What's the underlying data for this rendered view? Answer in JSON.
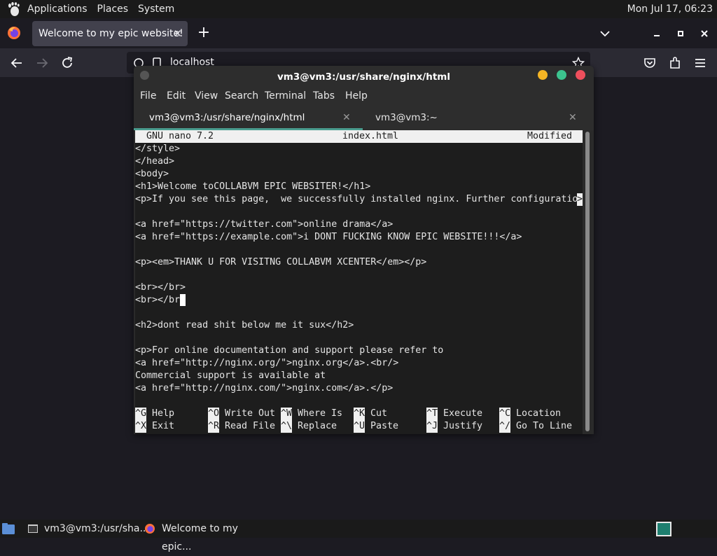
{
  "top_panel": {
    "menus": [
      "Applications",
      "Places",
      "System"
    ],
    "clock": "Mon Jul 17, 06:23"
  },
  "firefox": {
    "tab_title": "Welcome to my epic website!",
    "close_glyph": "✕",
    "newtab_glyph": "+",
    "url": "localhost",
    "icons": [
      "firefox-logo",
      "list-all-tabs",
      "minimize",
      "maximize",
      "close",
      "back",
      "forward",
      "reload",
      "site-info",
      "page",
      "bookmark-star",
      "pocket",
      "extensions",
      "hamburger-menu"
    ]
  },
  "terminal": {
    "title": "vm3@vm3:/usr/share/nginx/html",
    "menu": [
      "File",
      "Edit",
      "View",
      "Search",
      "Terminal",
      "Tabs",
      "Help"
    ],
    "tabs": [
      {
        "label": "vm3@vm3:/usr/share/nginx/html",
        "active": true
      },
      {
        "label": "vm3@vm3:~",
        "active": false
      }
    ],
    "tab_close_glyph": "✕",
    "colors": {
      "accent": "#4a9d8f",
      "yellow": "#f5b524",
      "green": "#3cc38e",
      "red": "#ee4f5c"
    }
  },
  "nano": {
    "version": "GNU nano 7.2",
    "filename": "index.html",
    "status": "Modified",
    "lines": [
      "</style>",
      "</head>",
      "<body>",
      "<h1>Welcome toCOLLABVM EPIC WEBSITER!</h1>",
      "<p>If you see this page,  we successfully installed nginx. Further configuratio",
      "",
      "<a href=\"https://twitter.com\">online drama</a>",
      "<a href=\"https://example.com\">i DONT FUCKING KNOW EPIC WEBSITE!!!</a>",
      "",
      "<p><em>THANK U FOR VISITNG COLLABVM XCENTER</em></p>",
      "",
      "<br></br>",
      "<br></br",
      "",
      "<h2>dont read shit below me it sux</h2>",
      "",
      "<p>For online documentation and support please refer to",
      "<a href=\"http://nginx.org/\">nginx.org</a>.<br/>",
      "Commercial support is available at",
      "<a href=\"http://nginx.com/\">nginx.com</a>.</p>"
    ],
    "truncation_marker": ">",
    "shortcuts_row1": [
      {
        "key": "^G",
        "label": "Help"
      },
      {
        "key": "^O",
        "label": "Write Out"
      },
      {
        "key": "^W",
        "label": "Where Is"
      },
      {
        "key": "^K",
        "label": "Cut"
      },
      {
        "key": "^T",
        "label": "Execute"
      },
      {
        "key": "^C",
        "label": "Location"
      }
    ],
    "shortcuts_row2": [
      {
        "key": "^X",
        "label": "Exit"
      },
      {
        "key": "^R",
        "label": "Read File"
      },
      {
        "key": "^\\",
        "label": "Replace"
      },
      {
        "key": "^U",
        "label": "Paste"
      },
      {
        "key": "^J",
        "label": "Justify"
      },
      {
        "key": "^/",
        "label": "Go To Line"
      }
    ]
  },
  "taskbar": {
    "items": [
      {
        "label": "vm3@vm3:/usr/sha...",
        "icon": "terminal-icon"
      },
      {
        "label": "Welcome to my epic...",
        "icon": "firefox-icon"
      }
    ]
  }
}
